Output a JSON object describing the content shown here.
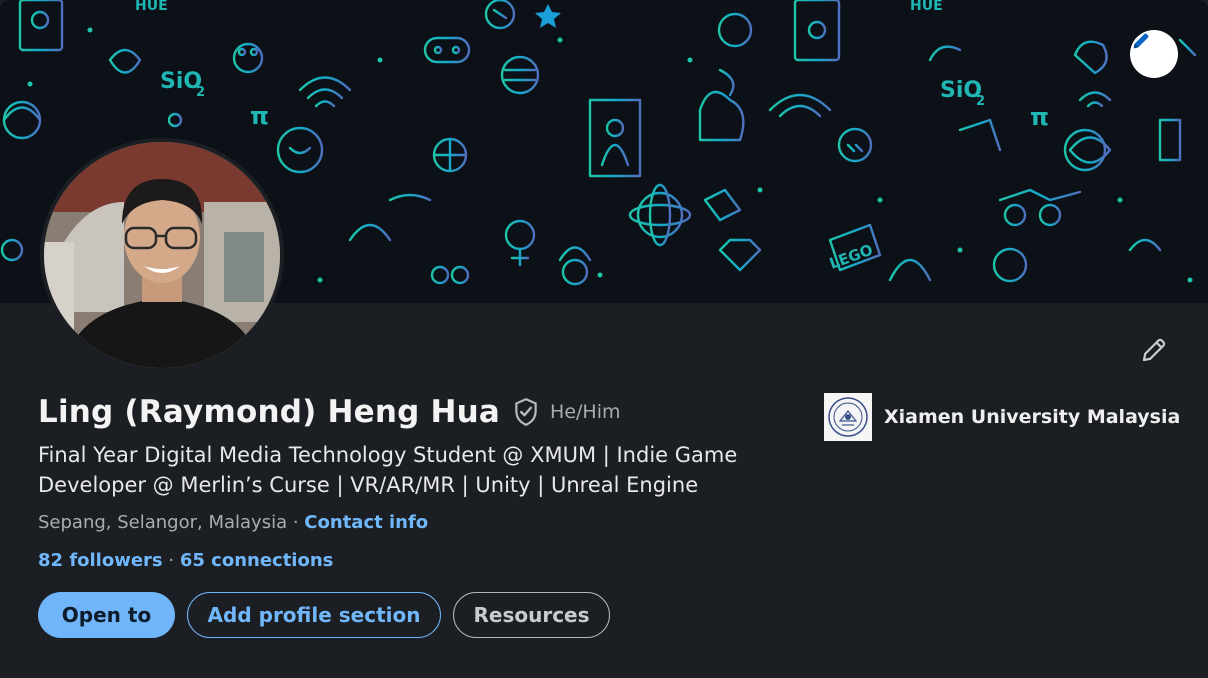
{
  "profile": {
    "name": "Ling (Raymond) Heng Hua",
    "pronouns": "He/Him",
    "headline_line1": "Final Year Digital Media Technology Student @ XMUM | Indie Game",
    "headline_line2": "Developer @ Merlin’s Curse | VR/AR/MR | Unity | Unreal Engine",
    "location": "Sepang, Selangor, Malaysia",
    "contact_link": "Contact info",
    "followers": "82 followers",
    "connections": "65 connections"
  },
  "education": {
    "school_name": "Xiamen University Malaysia"
  },
  "actions": {
    "open_to": "Open to",
    "add_section": "Add profile section",
    "resources": "Resources"
  },
  "banner": {
    "text_sio2": "SiO",
    "text_sub2": "2",
    "text_pi": "π",
    "text_hue": "HUE",
    "text_lego": "LEGO"
  },
  "colors": {
    "accent": "#71b7fb",
    "background": "#1b1f23",
    "banner_doodle": "#1fb6b3"
  },
  "icons": {
    "banner_edit": "pencil-icon",
    "intro_edit": "pencil-icon",
    "verified": "verified-shield-icon"
  }
}
